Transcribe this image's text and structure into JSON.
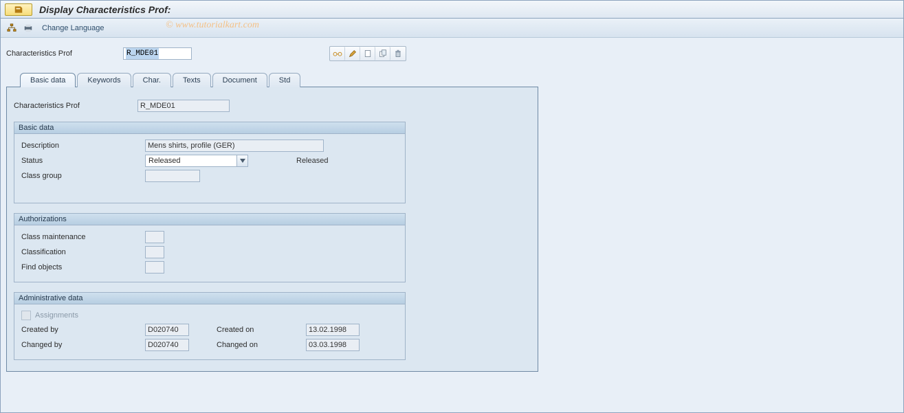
{
  "title": "Display Characteristics Prof:",
  "watermark": "© www.tutorialkart.com",
  "toolbar": {
    "change_language_label": "Change Language"
  },
  "header_field": {
    "label": "Characteristics Prof",
    "value": "R_MDE01"
  },
  "tabs": [
    "Basic data",
    "Keywords",
    "Char.",
    "Texts",
    "Document",
    "Std"
  ],
  "active_tab": 0,
  "panel": {
    "char_prof_label": "Characteristics Prof",
    "char_prof_value": "R_MDE01"
  },
  "basic_data": {
    "title": "Basic data",
    "description_label": "Description",
    "description_value": "Mens shirts, profile (GER)",
    "status_label": "Status",
    "status_value": "Released",
    "status_text": "Released",
    "class_group_label": "Class group",
    "class_group_value": ""
  },
  "authorizations": {
    "title": "Authorizations",
    "rows": [
      {
        "label": "Class maintenance",
        "value": ""
      },
      {
        "label": "Classification",
        "value": ""
      },
      {
        "label": "Find objects",
        "value": ""
      }
    ]
  },
  "admin": {
    "title": "Administrative data",
    "assignments_label": "Assignments",
    "created_by_label": "Created by",
    "created_by_value": "D020740",
    "created_on_label": "Created on",
    "created_on_value": "13.02.1998",
    "changed_by_label": "Changed by",
    "changed_by_value": "D020740",
    "changed_on_label": "Changed on",
    "changed_on_value": "03.03.1998"
  }
}
